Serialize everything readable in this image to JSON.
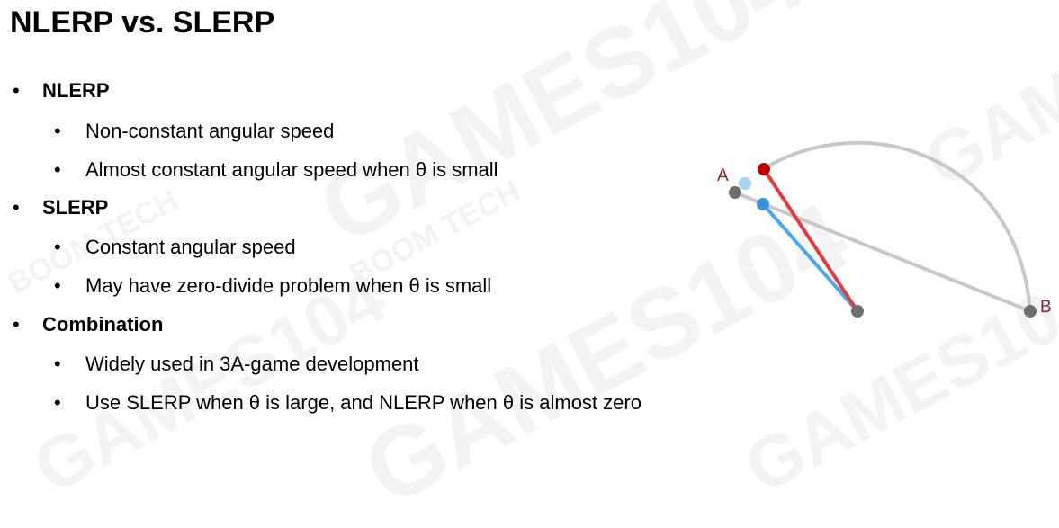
{
  "slide": {
    "title": "NLERP vs. SLERP",
    "sections": [
      {
        "heading": "NLERP",
        "items": [
          "Non-constant angular speed",
          "Almost constant angular speed when θ is small"
        ]
      },
      {
        "heading": "SLERP",
        "items": [
          "Constant angular speed",
          "May have zero-divide problem when θ is small"
        ]
      },
      {
        "heading": "Combination",
        "items": [
          "Widely used in 3A-game development",
          "Use SLERP when θ is large, and NLERP when θ  is almost zero"
        ]
      }
    ],
    "bullet_glyph": "•"
  },
  "diagram": {
    "label_a": "A",
    "label_b": "B",
    "colors": {
      "arc": "#c8c8c8",
      "chord": "#c8c8c8",
      "slerp_line": "#e8393c",
      "slerp_point": "#c00000",
      "nlerp_line": "#4aa8ee",
      "nlerp_point": "#3d8fe0",
      "nlerp_inner_point": "#a8d2f4",
      "endpoint": "#6e6e6e",
      "label": "#8b2323"
    }
  },
  "watermark": {
    "text_games": "GAMES104",
    "text_boom": "BOOM TECH"
  }
}
